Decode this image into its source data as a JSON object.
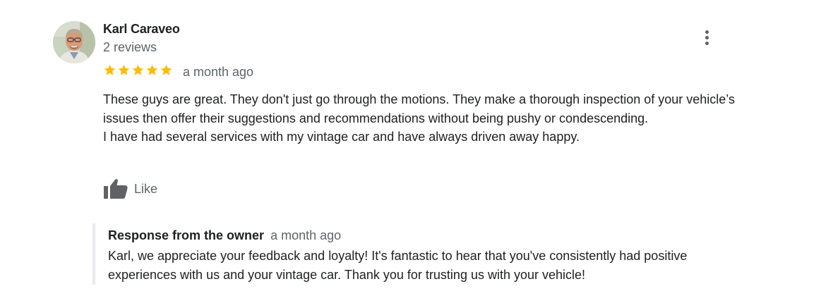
{
  "review": {
    "reviewer_name": "Karl Caraveo",
    "review_count": "2 reviews",
    "rating": 5,
    "max_rating": 5,
    "date": "a month ago",
    "text_paragraphs": [
      "These guys are great. They don't just go through the motions. They make a thorough inspection of your vehicle’s issues then offer their suggestions and recommendations without being pushy or condescending.",
      "I have had several services with my vintage car and have always driven away happy."
    ],
    "like_label": "Like",
    "icons": {
      "more": "more-vert-icon",
      "star": "star-icon",
      "like": "thumbs-up-icon"
    },
    "colors": {
      "star": "#fbbc04",
      "secondary_text": "#5f6368",
      "primary_text": "#202124",
      "response_border": "#e8eaed"
    }
  },
  "owner_response": {
    "title": "Response from the owner",
    "date": "a month ago",
    "text": "Karl, we appreciate your feedback and loyalty! It's fantastic to hear that you've consistently had positive experiences with us and your vintage car. Thank you for trusting us with your vehicle!"
  }
}
